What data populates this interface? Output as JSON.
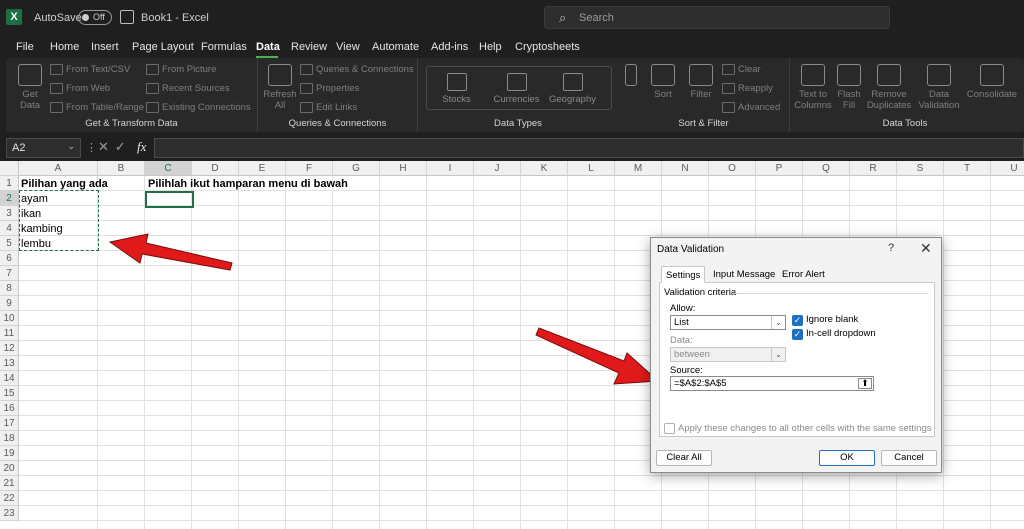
{
  "titlebar": {
    "autosave_label": "AutoSave",
    "toggle_state": "Off",
    "doc_title": "Book1  -  Excel",
    "search_placeholder": "Search"
  },
  "menu": [
    "File",
    "Home",
    "Insert",
    "Page Layout",
    "Formulas",
    "Data",
    "Review",
    "View",
    "Automate",
    "Add-ins",
    "Help",
    "Cryptosheets"
  ],
  "ribbon": {
    "get_data": "Get Data",
    "from_text": "From Text/CSV",
    "from_web": "From Web",
    "from_table": "From Table/Range",
    "from_picture": "From Picture",
    "recent_sources": "Recent Sources",
    "existing_connections": "Existing Connections",
    "group_get": "Get & Transform Data",
    "refresh_all": "Refresh All",
    "queries_connections": "Queries & Connections",
    "properties": "Properties",
    "edit_links": "Edit Links",
    "group_queries": "Queries & Connections",
    "stocks": "Stocks",
    "currencies": "Currencies",
    "geography": "Geography",
    "group_types": "Data Types",
    "sort": "Sort",
    "filter": "Filter",
    "clear": "Clear",
    "reapply": "Reapply",
    "advanced": "Advanced",
    "group_sort": "Sort & Filter",
    "text_to_columns": "Text to Columns",
    "flash_fill": "Flash Fill",
    "remove_duplicates": "Remove Duplicates",
    "data_validation": "Data Validation",
    "consolidate": "Consolidate",
    "group_tools": "Data Tools"
  },
  "formula_bar": {
    "name_box": "A2",
    "fx": "fx",
    "value": ""
  },
  "columns": [
    "A",
    "B",
    "C",
    "D",
    "E",
    "F",
    "G",
    "H",
    "I",
    "J",
    "K",
    "L",
    "M",
    "N",
    "O",
    "P",
    "Q",
    "R",
    "S",
    "T",
    "U"
  ],
  "rows": [
    "1",
    "2",
    "3",
    "4",
    "5",
    "6",
    "7",
    "8",
    "9",
    "10",
    "11",
    "12",
    "13",
    "14",
    "15",
    "16",
    "17",
    "18",
    "19",
    "20",
    "21",
    "22",
    "23"
  ],
  "cells": {
    "A1": "Pilihan yang ada",
    "C1": "Pilihlah ikut hamparan menu di bawah",
    "A2": "ayam",
    "A3": "ikan",
    "A4": "kambing",
    "A5": "lembu"
  },
  "dialog": {
    "title": "Data Validation",
    "help": "?",
    "close": "✕",
    "tabs": [
      "Settings",
      "Input Message",
      "Error Alert"
    ],
    "criteria_label": "Validation criteria",
    "allow_label": "Allow:",
    "allow_value": "List",
    "ignore_blank": "Ignore blank",
    "in_cell_dropdown": "In-cell dropdown",
    "data_label": "Data:",
    "data_value": "between",
    "source_label": "Source:",
    "source_value": "=$A$2:$A$5",
    "apply_all": "Apply these changes to all other cells with the same settings",
    "clear_all": "Clear All",
    "ok": "OK",
    "cancel": "Cancel"
  },
  "colors": {
    "accent": "#1e7145",
    "arrow": "#e01a1a",
    "checkbox": "#1f6fc3"
  }
}
